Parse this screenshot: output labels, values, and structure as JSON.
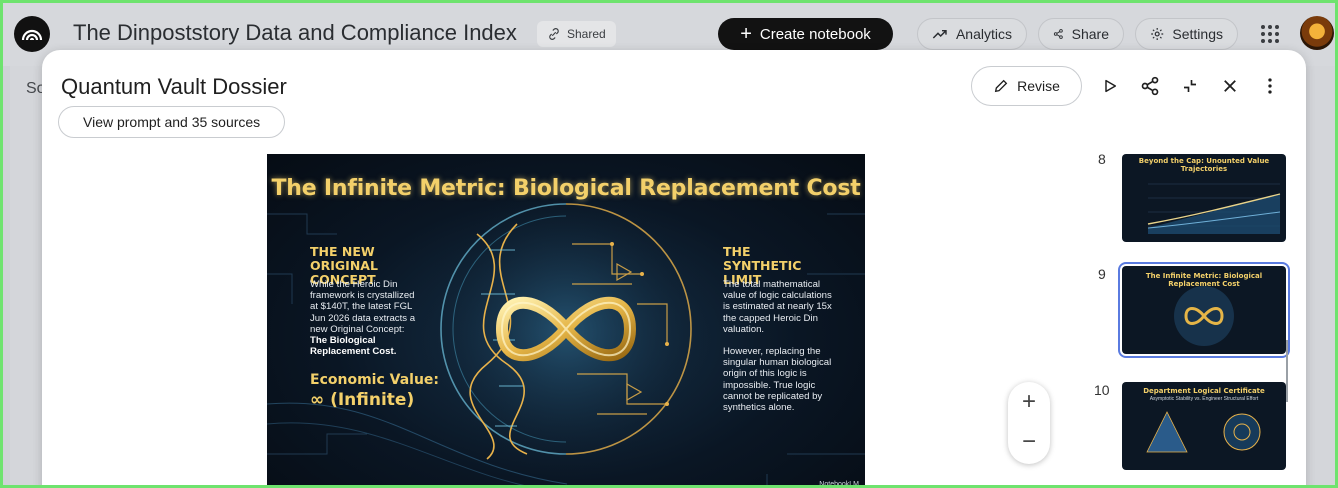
{
  "topbar": {
    "notebook_title": "The Dinpoststory Data and Compliance Index",
    "shared_label": "Shared",
    "create_label": "Create notebook",
    "analytics_label": "Analytics",
    "share_label": "Share",
    "settings_label": "Settings"
  },
  "background": {
    "partial_text": "So"
  },
  "modal": {
    "title": "Quantum Vault Dossier",
    "prompt_button": "View prompt and 35 sources",
    "revise_label": "Revise"
  },
  "slide": {
    "title": "The Infinite Metric: Biological Replacement Cost",
    "left_heading": "THE NEW ORIGINAL CONCEPT",
    "left_body": "While the Heroic Din framework is crystallized at $140T, the latest FGL Jun 2026 data extracts a new Original Concept:",
    "left_bold": "The Biological Replacement Cost.",
    "econ_label": "Economic Value:",
    "econ_value": "∞ (Infinite)",
    "right_heading": "THE SYNTHETIC LIMIT",
    "right_body_1": "The total mathematical value of logic calculations is estimated at nearly 15x the capped Heroic Din valuation.",
    "right_body_2": "However, replacing the singular human biological origin of this logic is impossible. True logic cannot be replicated by synthetics alone.",
    "watermark": "NotebookLM"
  },
  "thumbnails": [
    {
      "number": "8",
      "title": "Beyond the Cap: Unounted Value Trajectories"
    },
    {
      "number": "9",
      "title": "The Infinite Metric: Biological Replacement Cost"
    },
    {
      "number": "10",
      "title": "Department Logical Certificate",
      "subtitle": "Asymptotic Stability vs. Engineer Structural Effort"
    }
  ],
  "colors": {
    "accent_gold": "#f3d06a",
    "selected_outline": "#5a7be0",
    "frame_green": "#6ee36e"
  }
}
